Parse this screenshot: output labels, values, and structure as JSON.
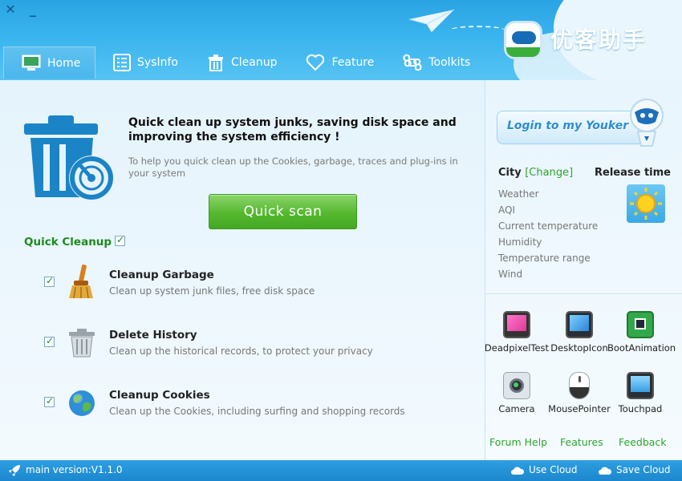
{
  "window": {
    "close_glyph": "✕",
    "minimize_glyph": "_"
  },
  "brand": {
    "name": "优客助手",
    "colors": {
      "header": "#2aa3e3",
      "accent_green": "#55b82f",
      "link_green": "#2ea52e"
    }
  },
  "nav": {
    "tabs": [
      {
        "label": "Home",
        "icon": "monitor-icon",
        "active": true
      },
      {
        "label": "SysInfo",
        "icon": "list-icon",
        "active": false
      },
      {
        "label": "Cleanup",
        "icon": "trash-icon",
        "active": false
      },
      {
        "label": "Feature",
        "icon": "heart-icon",
        "active": false
      },
      {
        "label": "Toolkits",
        "icon": "command-icon",
        "active": false
      }
    ]
  },
  "main": {
    "intro_title": "Quick clean up system junks, saving disk space and improving the system efficiency !",
    "intro_desc": "To help you quick clean up the Cookies, garbage, traces and plug-ins in your system",
    "scan_button": "Quick scan",
    "quick_cleanup_label": "Quick Cleanup",
    "items": [
      {
        "title": "Cleanup Garbage",
        "desc": "Clean up system junk files, free disk space",
        "checked": true,
        "icon": "broom-icon"
      },
      {
        "title": "Delete History",
        "desc": "Clean up the historical records, to protect your privacy",
        "checked": true,
        "icon": "trashcan-icon"
      },
      {
        "title": "Cleanup Cookies",
        "desc": "Clean up the Cookies, including surfing and shopping records",
        "checked": true,
        "icon": "globe-icon"
      }
    ]
  },
  "side": {
    "login_label": "Login to my Youker",
    "city_label": "City",
    "city_change": "[Change]",
    "release_label": "Release time",
    "weather_fields": [
      "Weather",
      "AQI",
      "Current temperature",
      "Humidity",
      "Temperature range",
      "Wind"
    ],
    "tools": [
      {
        "label": "DeadpixelTest",
        "icon": "deadpixel-icon"
      },
      {
        "label": "DesktopIcon",
        "icon": "desktop-icon"
      },
      {
        "label": "BootAnimation",
        "icon": "film-icon"
      },
      {
        "label": "Camera",
        "icon": "camera-icon"
      },
      {
        "label": "MousePointer",
        "icon": "mouse-icon"
      },
      {
        "label": "Touchpad",
        "icon": "touchpad-icon"
      }
    ],
    "links": {
      "forum": "Forum Help",
      "features": "Features",
      "feedback": "Feedback"
    }
  },
  "status": {
    "version": "main version:V1.1.0",
    "use_cloud": "Use Cloud",
    "save_cloud": "Save Cloud"
  }
}
